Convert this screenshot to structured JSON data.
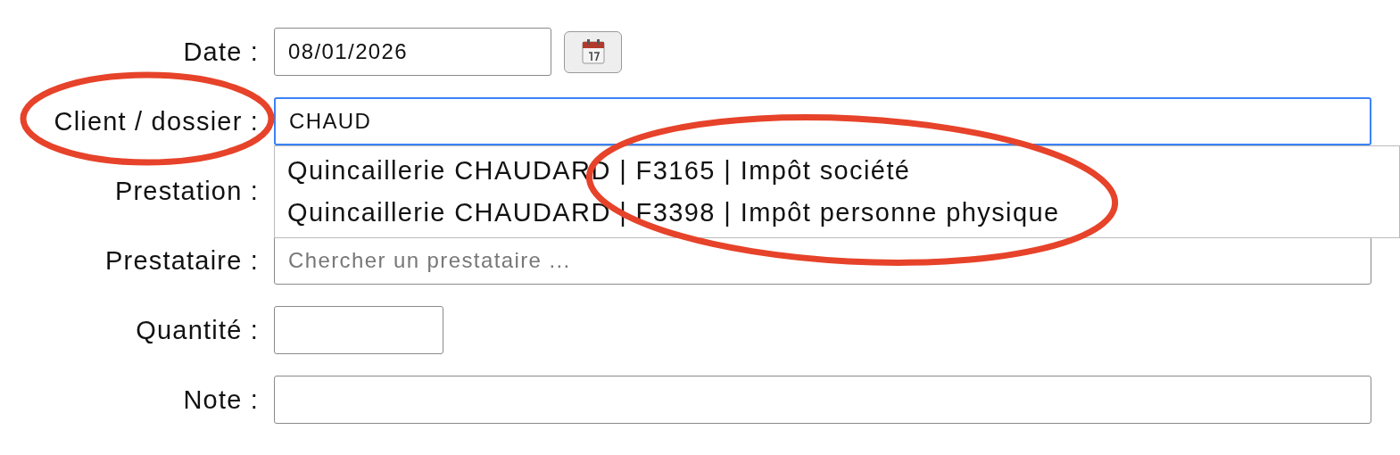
{
  "form": {
    "rows": [
      {
        "label": "Date :",
        "kind": "date",
        "value": "08/01/2026",
        "focused": false
      },
      {
        "label": "Client / dossier :",
        "kind": "search",
        "value": "CHAUD",
        "focused": true,
        "suggestions": [
          "Quincaillerie CHAUDARD | F3165 | Impôt société",
          "Quincaillerie CHAUDARD | F3398 | Impôt personne physique"
        ]
      },
      {
        "label": "Prestation :",
        "kind": "covered"
      },
      {
        "label": "Prestataire :",
        "kind": "search",
        "placeholder": "Chercher un prestataire ...",
        "focused": false
      },
      {
        "label": "Quantité :",
        "kind": "short",
        "value": "",
        "focused": false
      },
      {
        "label": "Note :",
        "kind": "text",
        "value": "",
        "focused": false
      }
    ]
  }
}
